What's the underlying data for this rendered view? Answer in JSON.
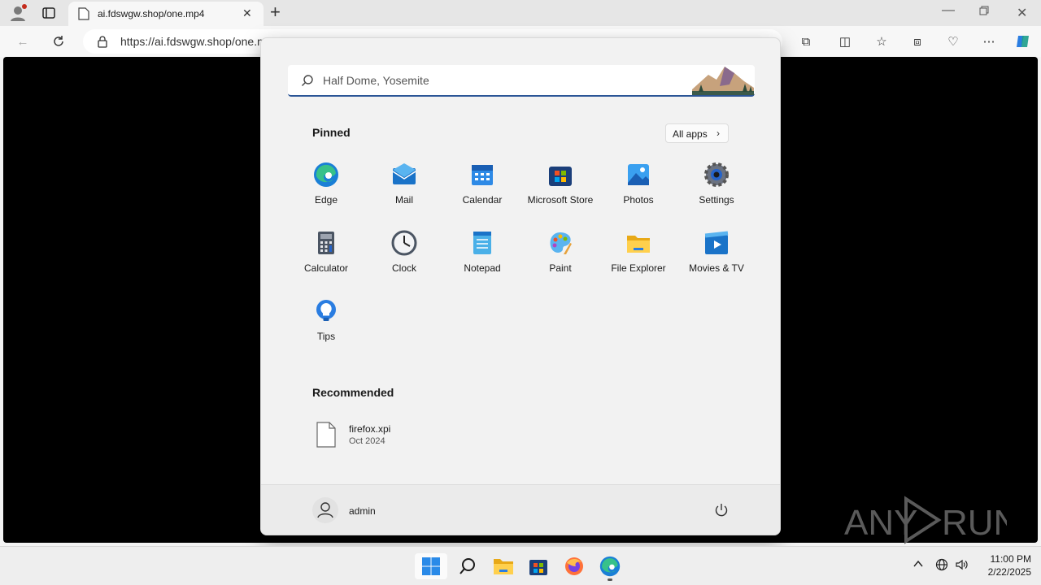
{
  "browser": {
    "tab_title": "ai.fdswgw.shop/one.mp4",
    "url": "https://ai.fdswgw.shop/one.m",
    "new_tab_symbol": "+"
  },
  "start_menu": {
    "search_placeholder": "Half Dome, Yosemite",
    "pinned_heading": "Pinned",
    "all_apps_label": "All apps",
    "pinned": [
      {
        "label": "Edge",
        "icon": "edge-icon"
      },
      {
        "label": "Mail",
        "icon": "mail-icon"
      },
      {
        "label": "Calendar",
        "icon": "calendar-icon"
      },
      {
        "label": "Microsoft Store",
        "icon": "store-icon"
      },
      {
        "label": "Photos",
        "icon": "photos-icon"
      },
      {
        "label": "Settings",
        "icon": "settings-icon"
      },
      {
        "label": "Calculator",
        "icon": "calculator-icon"
      },
      {
        "label": "Clock",
        "icon": "clock-icon"
      },
      {
        "label": "Notepad",
        "icon": "notepad-icon"
      },
      {
        "label": "Paint",
        "icon": "paint-icon"
      },
      {
        "label": "File Explorer",
        "icon": "folder-icon"
      },
      {
        "label": "Movies & TV",
        "icon": "movies-icon"
      },
      {
        "label": "Tips",
        "icon": "tips-icon"
      }
    ],
    "recommended_heading": "Recommended",
    "recommended": [
      {
        "name": "firefox.xpi",
        "date": "Oct 2024",
        "icon": "file-icon"
      }
    ],
    "user_name": "admin"
  },
  "watermark": "ANY RUN",
  "taskbar": {
    "time": "11:00 PM",
    "date": "2/22/2025"
  },
  "colors": {
    "accent": "#2b5596",
    "start_bg": "#f2f2f2",
    "content_bg": "#000000"
  }
}
